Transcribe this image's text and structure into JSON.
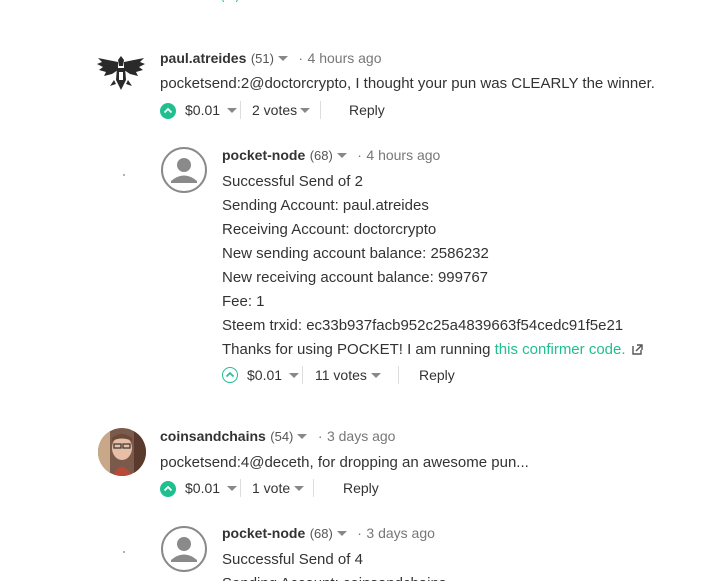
{
  "comments": [
    {
      "author": "paul.atreides",
      "rep": "(51)",
      "time": "4 hours ago",
      "body": "pocketsend:2@doctorcrypto, I thought your pun was CLEARLY the winner.",
      "payout": "$0.01",
      "votes": "2 votes",
      "reply": "Reply"
    },
    {
      "author": "pocket-node",
      "rep": "(68)",
      "time": "4 hours ago",
      "lines": [
        "Successful Send of 2",
        "Sending Account: paul.atreides",
        "Receiving Account: doctorcrypto",
        "New sending account balance: 2586232",
        "New receiving account balance: 999767",
        "Fee: 1",
        "Steem trxid: ec33b937facb952c25a4839663f54cedc91f5e21"
      ],
      "thanks_prefix": "Thanks for using POCKET! I am running ",
      "thanks_link": "this confirmer code.",
      "payout": "$0.01",
      "votes": "11 votes",
      "reply": "Reply"
    },
    {
      "author": "coinsandchains",
      "rep": "(54)",
      "time": "3 days ago",
      "body": "pocketsend:4@deceth, for dropping an awesome pun...",
      "payout": "$0.01",
      "votes": "1 vote",
      "reply": "Reply"
    },
    {
      "author": "pocket-node",
      "rep": "(68)",
      "time": "3 days ago",
      "line1": "Successful Send of 4",
      "line2_partial": "Sending Account: coinsandchains"
    }
  ],
  "colors": {
    "accent": "#1fbf8f"
  },
  "icons": {
    "upvote": "upvote-chevron-icon",
    "external": "external-link-icon"
  }
}
